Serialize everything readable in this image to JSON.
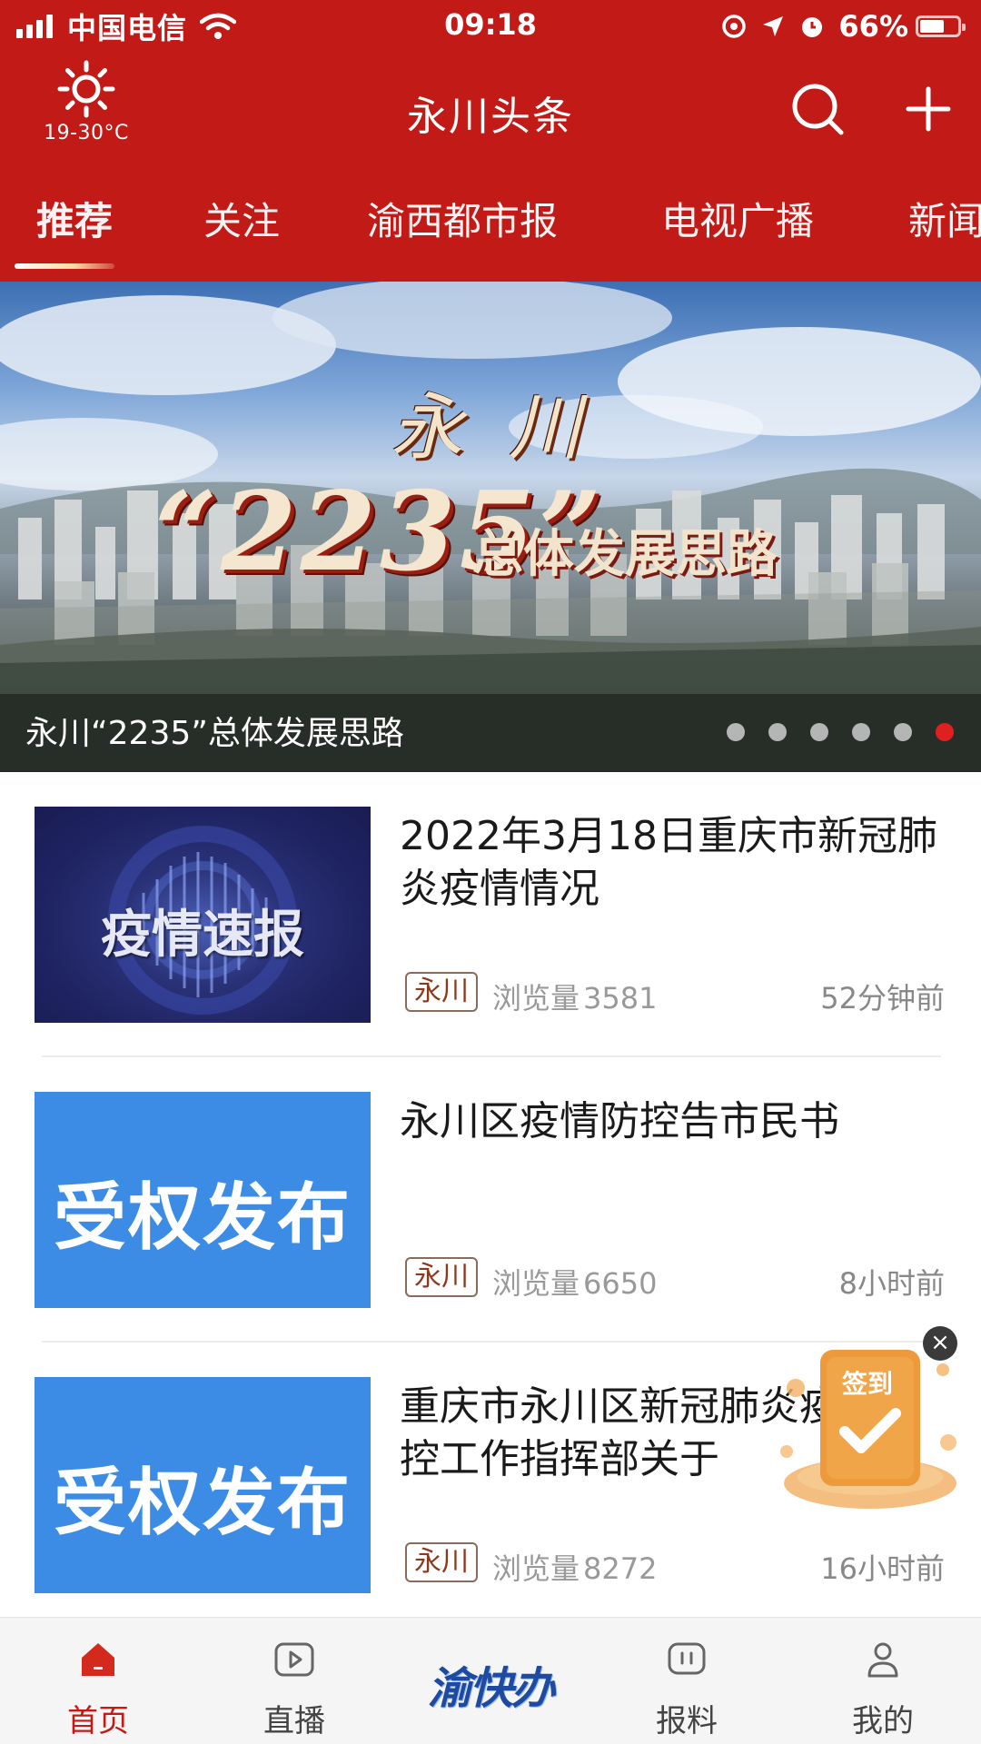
{
  "status_bar": {
    "carrier": "中国电信",
    "time": "09:18",
    "battery": "66%",
    "battery_level": 0.66
  },
  "weather": {
    "icon": "sun-icon",
    "temperature": "19-30°C"
  },
  "header": {
    "title": "永川头条",
    "search_icon": "search-icon",
    "add_icon": "plus-icon"
  },
  "tabs": [
    {
      "label": "推荐",
      "active": true
    },
    {
      "label": "关注"
    },
    {
      "label": "渝西都市报"
    },
    {
      "label": "电视广播"
    },
    {
      "label": "新闻"
    }
  ],
  "banner": {
    "art_calligraphy": "永川",
    "art_number": "“2235”",
    "art_subtitle": "总体发展思路",
    "caption": "永川“2235”总体发展思路",
    "dot_count": 6,
    "active_dot": 6
  },
  "news": [
    {
      "thumb_text": "疫情速报",
      "title": "2022年3月18日重庆市新冠肺炎疫情情况",
      "source": "永川",
      "views_label": "浏览量",
      "views": "3581",
      "time": "52分钟前"
    },
    {
      "thumb_text": "受权发布",
      "title": "永川区疫情防控告市民书",
      "source": "永川",
      "views_label": "浏览量",
      "views": "6650",
      "time": "8小时前"
    },
    {
      "thumb_text": "受权发布",
      "title": "重庆市永川区新冠肺炎疫情防控工作指挥部关于",
      "source": "永川",
      "views_label": "浏览量",
      "views": "8272",
      "time": "16小时前"
    }
  ],
  "checkin": {
    "label": "签到",
    "close": "×"
  },
  "bottom_nav": [
    {
      "label": "首页",
      "icon": "home-icon",
      "active": true
    },
    {
      "label": "直播",
      "icon": "play-icon"
    },
    {
      "label": "渝快办",
      "icon": "yukuaiban-logo"
    },
    {
      "label": "报料",
      "icon": "report-icon"
    },
    {
      "label": "我的",
      "icon": "user-icon"
    }
  ],
  "colors": {
    "brand_red": "#c21b17",
    "authority_blue": "#3c8ce6",
    "active_dot": "#e02020"
  }
}
